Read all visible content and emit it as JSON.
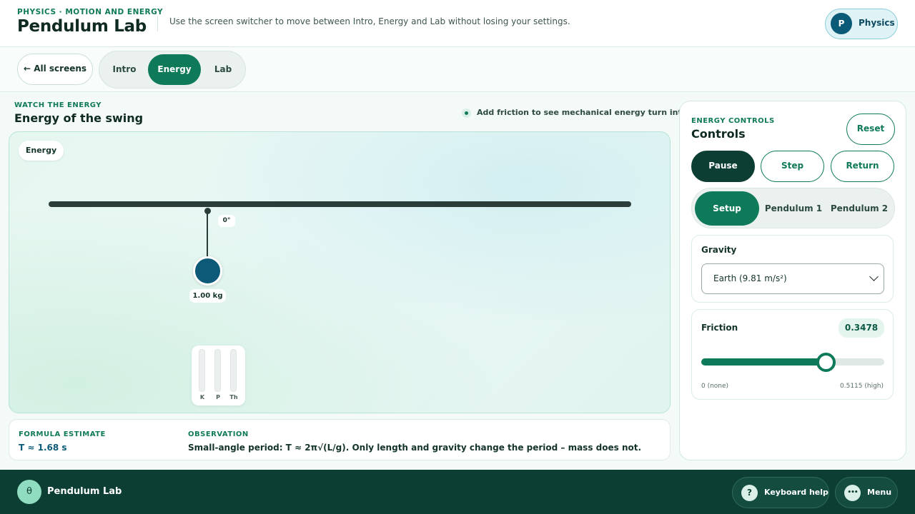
{
  "header": {
    "eyebrow": "PHYSICS · MOTION AND ENERGY",
    "title": "Pendulum Lab",
    "hint": "Use the screen switcher to move between Intro, Energy and Lab without losing your settings.",
    "subject_initial": "P",
    "subject_label": "Physics"
  },
  "nav": {
    "all_screens_label": "← All screens",
    "tabs": [
      {
        "label": "Intro"
      },
      {
        "label": "Energy"
      },
      {
        "label": "Lab"
      }
    ],
    "active_tab": "Energy"
  },
  "section": {
    "eyebrow": "WATCH THE ENERGY",
    "title": "Energy of the swing",
    "note": "Add friction to see mechanical energy turn into heat."
  },
  "stage": {
    "badge": "Energy",
    "angle": "0°",
    "mass": "1.00 kg",
    "meters": [
      {
        "label": "K",
        "level": 0
      },
      {
        "label": "P",
        "level": 0
      },
      {
        "label": "Th",
        "level": 0
      }
    ]
  },
  "formula": {
    "eyebrow": "FORMULA ESTIMATE",
    "value": "T ≈ 1.68 s",
    "observation_eyebrow": "OBSERVATION",
    "observation": "Small-angle period: T ≈ 2π√(L/g). Only length and gravity change the period – mass does not."
  },
  "panel": {
    "eyebrow": "ENERGY CONTROLS",
    "title": "Controls",
    "reset_label": "Reset",
    "buttons": [
      {
        "label": "Pause"
      },
      {
        "label": "Step"
      },
      {
        "label": "Return"
      }
    ],
    "segments": [
      {
        "label": "Setup"
      },
      {
        "label": "Pendulum 1"
      },
      {
        "label": "Pendulum 2"
      }
    ],
    "active_segment": "Setup",
    "gravity": {
      "label": "Gravity",
      "selected": "Earth (9.81 m/s²)"
    },
    "friction": {
      "label": "Friction",
      "value": "0.3478",
      "fraction": 0.68,
      "min_label": "0 (none)",
      "max_label": "0.5115 (high)"
    }
  },
  "footer": {
    "logo_glyph": "θ",
    "title": "Pendulum Lab",
    "help_icon": "?",
    "help_label": "Keyboard help",
    "menu_icon": "•••",
    "menu_label": "Menu"
  },
  "colors": {
    "accent": "#0f7a5a",
    "dark": "#0c3e33",
    "bob": "#0c5a78"
  }
}
